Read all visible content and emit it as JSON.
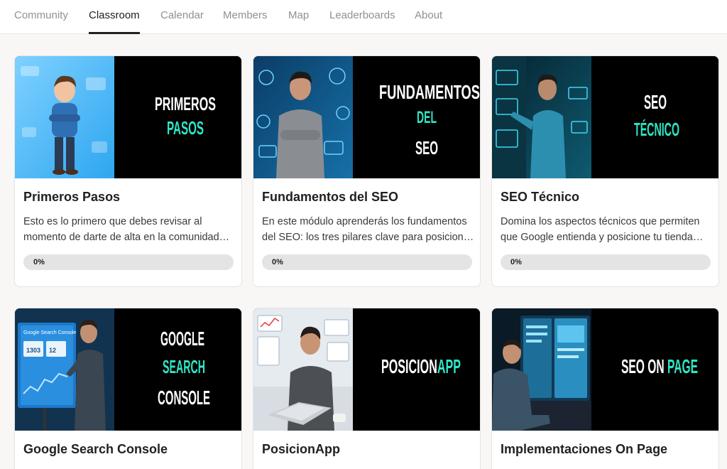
{
  "nav": {
    "tabs": [
      {
        "label": "Community"
      },
      {
        "label": "Classroom",
        "active": true
      },
      {
        "label": "Calendar"
      },
      {
        "label": "Members"
      },
      {
        "label": "Map"
      },
      {
        "label": "Leaderboards"
      },
      {
        "label": "About"
      }
    ]
  },
  "colors": {
    "accent_teal": "#2ee6c5",
    "thumb_black": "#000000",
    "progress_track": "#e4e4e4"
  },
  "courses": [
    {
      "title": "Primeros Pasos",
      "description_lines": [
        "Esto es lo primero que debes revisar al",
        "momento de darte de alta en la comunidad…"
      ],
      "progress_label": "0%",
      "progress": 0,
      "thumb_lines": [
        {
          "text": "PRIMEROS",
          "color": "#ffffff"
        },
        {
          "text": "PASOS",
          "color": "#2ee6c5"
        }
      ]
    },
    {
      "title": "Fundamentos del SEO",
      "description_lines": [
        "En este módulo aprenderás los fundamentos",
        "del SEO: los tres pilares clave para posicion…"
      ],
      "progress_label": "0%",
      "progress": 0,
      "thumb_lines": [
        {
          "text": "FUNDAMENTOS",
          "color": "#ffffff"
        },
        {
          "text": "DEL",
          "color": "#2ee6c5"
        },
        {
          "text": "SEO",
          "color": "#ffffff"
        }
      ]
    },
    {
      "title": "SEO Técnico",
      "description_lines": [
        "Domina los aspectos técnicos que permiten",
        "que Google entienda y posicione tu tienda…"
      ],
      "progress_label": "0%",
      "progress": 0,
      "thumb_lines": [
        {
          "text": "SEO",
          "color": "#ffffff"
        },
        {
          "text": "TÉCNICO",
          "color": "#2ee6c5"
        }
      ]
    },
    {
      "title": "Google Search Console",
      "description_lines": [],
      "thumb_lines": [
        {
          "text": "GOOGLE",
          "color": "#ffffff"
        },
        {
          "text": "SEARCH",
          "color": "#2ee6c5"
        },
        {
          "text": "CONSOLE",
          "color": "#ffffff"
        }
      ],
      "screen_texts": {
        "heading": "Google Search Console",
        "kpi1": "1303",
        "kpi2": "12"
      }
    },
    {
      "title": "PosicionApp",
      "description_lines": [],
      "thumb_lines": [
        {
          "parts": [
            {
              "text": "POSICION",
              "color": "#ffffff"
            },
            {
              "text": "APP",
              "color": "#2ee6c5"
            }
          ]
        }
      ]
    },
    {
      "title": "Implementaciones On Page",
      "description_lines": [],
      "thumb_lines": [
        {
          "parts": [
            {
              "text": "SEO ON ",
              "color": "#ffffff"
            },
            {
              "text": "PAGE",
              "color": "#2ee6c5"
            }
          ]
        }
      ]
    }
  ]
}
